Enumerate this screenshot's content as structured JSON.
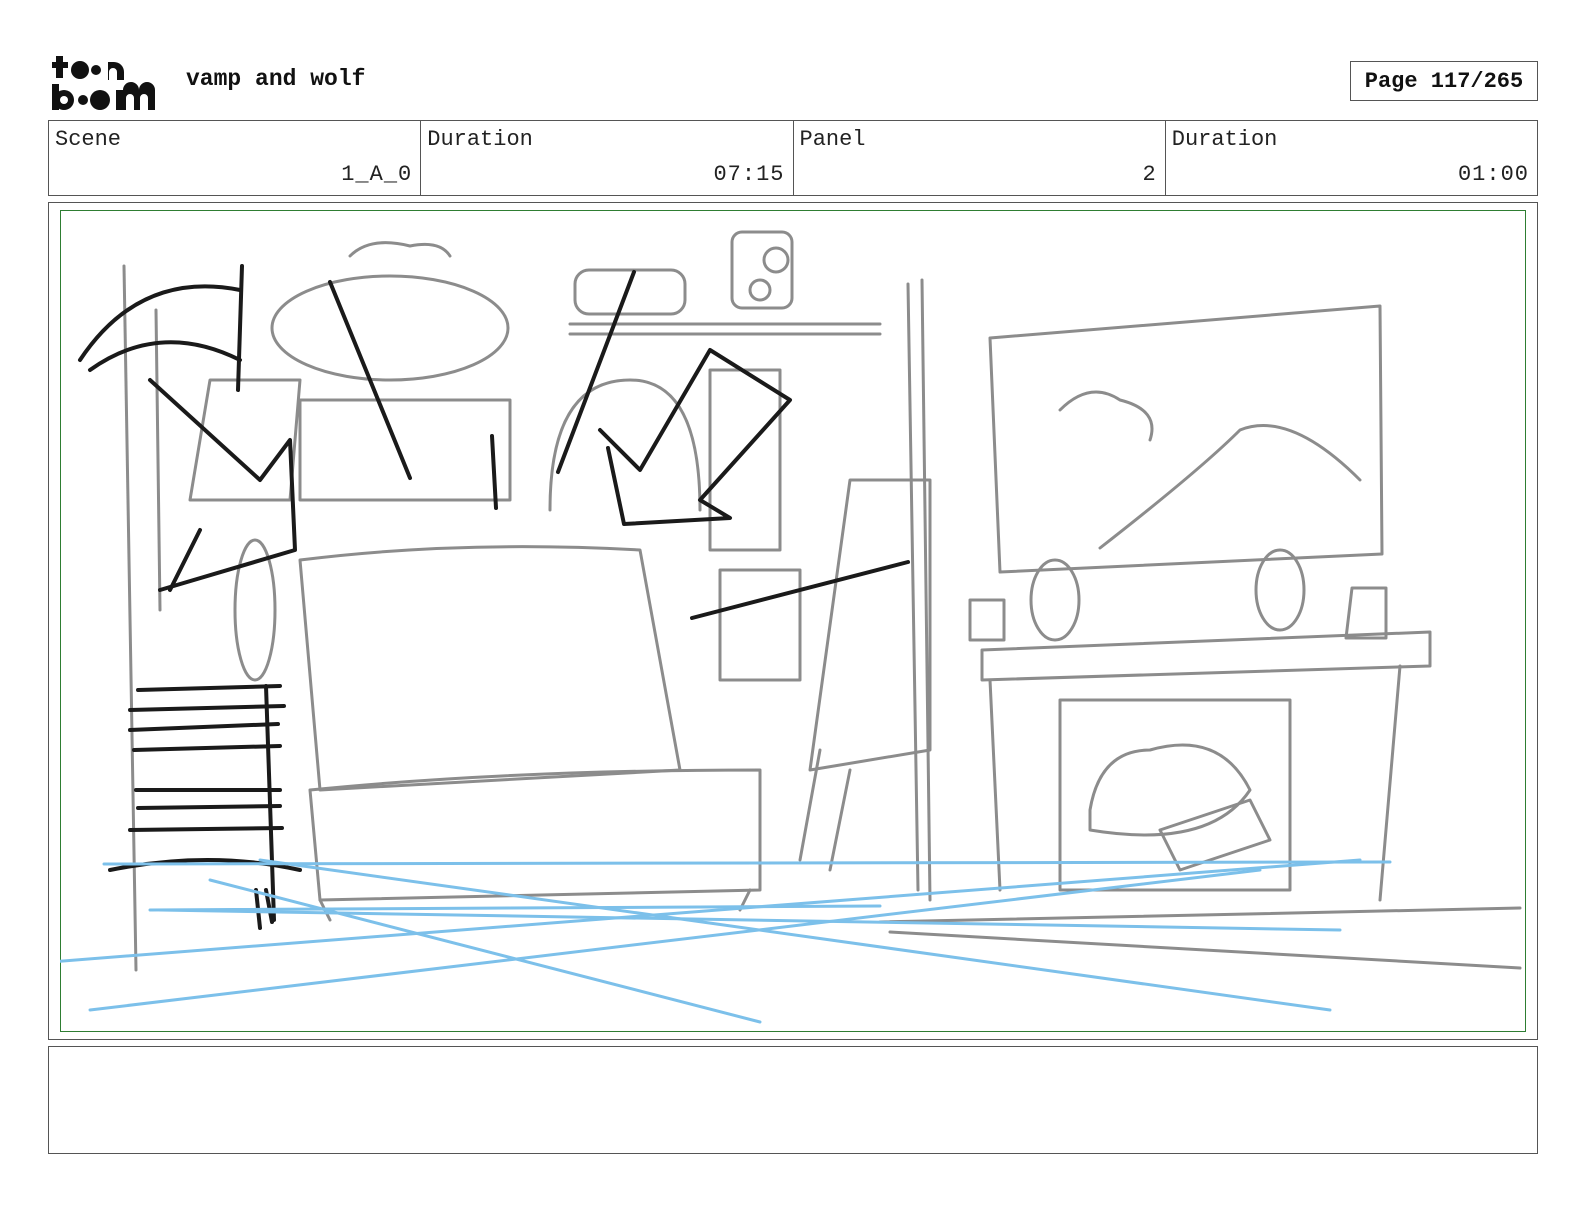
{
  "header": {
    "logo_text": "toon boom",
    "project_title": "vamp and wolf",
    "page_label": "Page 117/265"
  },
  "info": {
    "scene_label": "Scene",
    "scene_value": "1_A_0",
    "scene_duration_label": "Duration",
    "scene_duration_value": "07:15",
    "panel_label": "Panel",
    "panel_value": "2",
    "panel_duration_label": "Duration",
    "panel_duration_value": "01:00"
  },
  "panel": {
    "description": "",
    "frame_color": "#2e7d32",
    "sketch_color": "#8c8c8c",
    "ink_color": "#1a1a1a",
    "guide_color": "#7cc0ea"
  },
  "caption": {
    "text": ""
  }
}
